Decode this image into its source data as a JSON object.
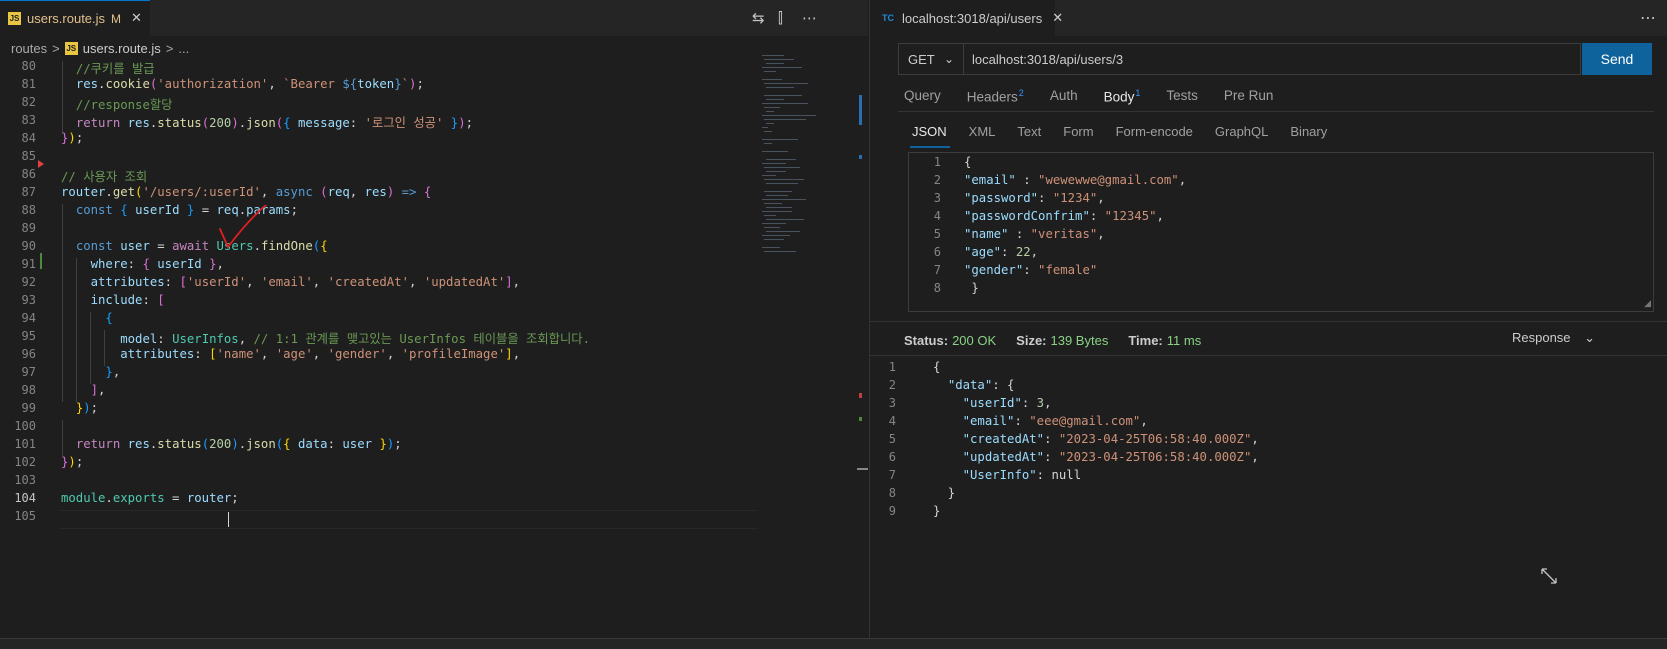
{
  "editor": {
    "tab": {
      "name": "users.route.js",
      "modified": "M",
      "close": "✕",
      "badge": "JS"
    },
    "toolbar": {
      "compare": "⇆",
      "split": "⫿",
      "more": "⋯"
    },
    "breadcrumb": {
      "folder": "routes",
      "sep": ">",
      "file": "users.route.js",
      "more": "..."
    },
    "lines": [
      {
        "n": "80",
        "html": "  <span class='cmt'>//쿠키를 발급</span>"
      },
      {
        "n": "81",
        "html": "  <span class='var'>res</span>.<span class='fn'>cookie</span><span class='br2'>(</span><span class='str'>'authorization'</span>, <span class='str'>`Bearer </span><span class='kw'>${</span><span class='var'>token</span><span class='kw'>}</span><span class='str'>`</span><span class='br2'>)</span>;"
      },
      {
        "n": "82",
        "html": "  <span class='cmt'>//response할당</span>"
      },
      {
        "n": "83",
        "html": "  <span class='ctl'>return</span> <span class='var'>res</span>.<span class='fn'>status</span><span class='br2'>(</span><span class='num'>200</span><span class='br2'>)</span>.<span class='fn'>json</span><span class='br2'>(</span><span class='br3'>{</span> <span class='var'>message</span>: <span class='str'>'로그인 성공'</span> <span class='br3'>}</span><span class='br2'>)</span>;"
      },
      {
        "n": "84",
        "html": "<span class='br2'>}</span><span class='br1'>)</span>;"
      },
      {
        "n": "85",
        "html": ""
      },
      {
        "n": "86",
        "html": "<span class='cmt'>// 사용자 조회</span>"
      },
      {
        "n": "87",
        "html": "<span class='var'>router</span>.<span class='fn'>get</span><span class='br1'>(</span><span class='str'>'/users/:userId'</span>, <span class='kw'>async</span> <span class='br2'>(</span><span class='var'>req</span>, <span class='var'>res</span><span class='br2'>)</span> <span class='kw'>=&gt;</span> <span class='br2'>{</span>"
      },
      {
        "n": "88",
        "html": "  <span class='kw'>const</span> <span class='br3'>{</span> <span class='var'>userId</span> <span class='br3'>}</span> = <span class='var'>req</span>.<span class='var'>params</span>;"
      },
      {
        "n": "89",
        "html": ""
      },
      {
        "n": "90",
        "html": "  <span class='kw'>const</span> <span class='var'>user</span> = <span class='ctl'>await</span> <span class='cls'>Users</span>.<span class='fn'>findOne</span><span class='br3'>(</span><span class='br1'>{</span>"
      },
      {
        "n": "91",
        "html": "    <span class='var'>where</span>: <span class='br2'>{</span> <span class='var'>userId</span> <span class='br2'>}</span>,"
      },
      {
        "n": "92",
        "html": "    <span class='var'>attributes</span>: <span class='br2'>[</span><span class='str'>'userId'</span>, <span class='str'>'email'</span>, <span class='str'>'createdAt'</span>, <span class='str'>'updatedAt'</span><span class='br2'>]</span>,"
      },
      {
        "n": "93",
        "html": "    <span class='var'>include</span>: <span class='br2'>[</span>"
      },
      {
        "n": "94",
        "html": "      <span class='br3'>{</span>"
      },
      {
        "n": "95",
        "html": "        <span class='var'>model</span>: <span class='cls'>UserInfos</span>, <span class='cmt'>// 1:1 관계를 맺고있는 UserInfos 테이블을 조회합니다.</span>"
      },
      {
        "n": "96",
        "html": "        <span class='var'>attributes</span>: <span class='br1'>[</span><span class='str'>'name'</span>, <span class='str'>'age'</span>, <span class='str'>'gender'</span>, <span class='str'>'profileImage'</span><span class='br1'>]</span>,"
      },
      {
        "n": "97",
        "html": "      <span class='br3'>}</span>,"
      },
      {
        "n": "98",
        "html": "    <span class='br2'>]</span>,"
      },
      {
        "n": "99",
        "html": "  <span class='br1'>}</span><span class='br3'>)</span>;"
      },
      {
        "n": "100",
        "html": ""
      },
      {
        "n": "101",
        "html": "  <span class='ctl'>return</span> <span class='var'>res</span>.<span class='fn'>status</span><span class='br3'>(</span><span class='num'>200</span><span class='br3'>)</span>.<span class='fn'>json</span><span class='br3'>(</span><span class='br1'>{</span> <span class='var'>data</span>: <span class='var'>user</span> <span class='br1'>}</span><span class='br3'>)</span>;"
      },
      {
        "n": "102",
        "html": "<span class='br2'>}</span><span class='br1'>)</span>;"
      },
      {
        "n": "103",
        "html": ""
      },
      {
        "n": "104",
        "html": "<span class='cls'>module</span>.<span class='cls'>exports</span> = <span class='var'>router</span>;"
      },
      {
        "n": "105",
        "html": ""
      }
    ]
  },
  "tc": {
    "tab": {
      "badge": "TC",
      "name": "localhost:3018/api/users",
      "close": "✕"
    },
    "more": "⋯",
    "method": "GET",
    "chevron": "⌄",
    "url": "localhost:3018/api/users/3",
    "send": "Send",
    "req_tabs": [
      {
        "label": "Query",
        "sup": ""
      },
      {
        "label": "Headers",
        "sup": "2"
      },
      {
        "label": "Auth",
        "sup": ""
      },
      {
        "label": "Body",
        "sup": "1"
      },
      {
        "label": "Tests",
        "sup": ""
      },
      {
        "label": "Pre Run",
        "sup": ""
      }
    ],
    "active_req_tab": "Body",
    "body_tabs": [
      "JSON",
      "XML",
      "Text",
      "Form",
      "Form-encode",
      "GraphQL",
      "Binary"
    ],
    "active_body_tab": "JSON",
    "request_lines": [
      {
        "n": "1",
        "html": "{"
      },
      {
        "n": "2",
        "html": "<span class='jk'>\"email\"</span> : <span class='js'>\"wewewwe@gmail.com\"</span>,"
      },
      {
        "n": "3",
        "html": "<span class='jk'>\"password\"</span>: <span class='js'>\"1234\"</span>,"
      },
      {
        "n": "4",
        "html": "<span class='jk'>\"passwordConfrim\"</span>: <span class='js'>\"12345\"</span>,"
      },
      {
        "n": "5",
        "html": "<span class='jk'>\"name\"</span> : <span class='js'>\"veritas\"</span>,"
      },
      {
        "n": "6",
        "html": "<span class='jk'>\"age\"</span>: <span class='jn'>22</span>,"
      },
      {
        "n": "7",
        "html": "<span class='jk'>\"gender\"</span>: <span class='js'>\"female\"</span>"
      },
      {
        "n": "8",
        "html": " }"
      }
    ],
    "status": {
      "status_label": "Status:",
      "status_val": "200 OK",
      "size_label": "Size:",
      "size_val": "139 Bytes",
      "time_label": "Time:",
      "time_val": "11 ms"
    },
    "response_select": "Response",
    "response_lines": [
      {
        "n": "1",
        "html": "{"
      },
      {
        "n": "2",
        "html": "  <span class='jk'>\"data\"</span>: {"
      },
      {
        "n": "3",
        "html": "    <span class='jk'>\"userId\"</span>: <span class='jn'>3</span>,"
      },
      {
        "n": "4",
        "html": "    <span class='jk'>\"email\"</span>: <span class='js'>\"eee@gmail.com\"</span>,"
      },
      {
        "n": "5",
        "html": "    <span class='jk'>\"createdAt\"</span>: <span class='js'>\"2023-04-25T06:58:40.000Z\"</span>,"
      },
      {
        "n": "6",
        "html": "    <span class='jk'>\"updatedAt\"</span>: <span class='js'>\"2023-04-25T06:58:40.000Z\"</span>,"
      },
      {
        "n": "7",
        "html": "    <span class='jk'>\"UserInfo\"</span>: <span class='jnull'>null</span>"
      },
      {
        "n": "8",
        "html": "  }"
      },
      {
        "n": "9",
        "html": "}"
      }
    ]
  },
  "colors": {
    "accent": "#0e639c",
    "status_ok": "#89d185",
    "annotation": "#e02020"
  }
}
